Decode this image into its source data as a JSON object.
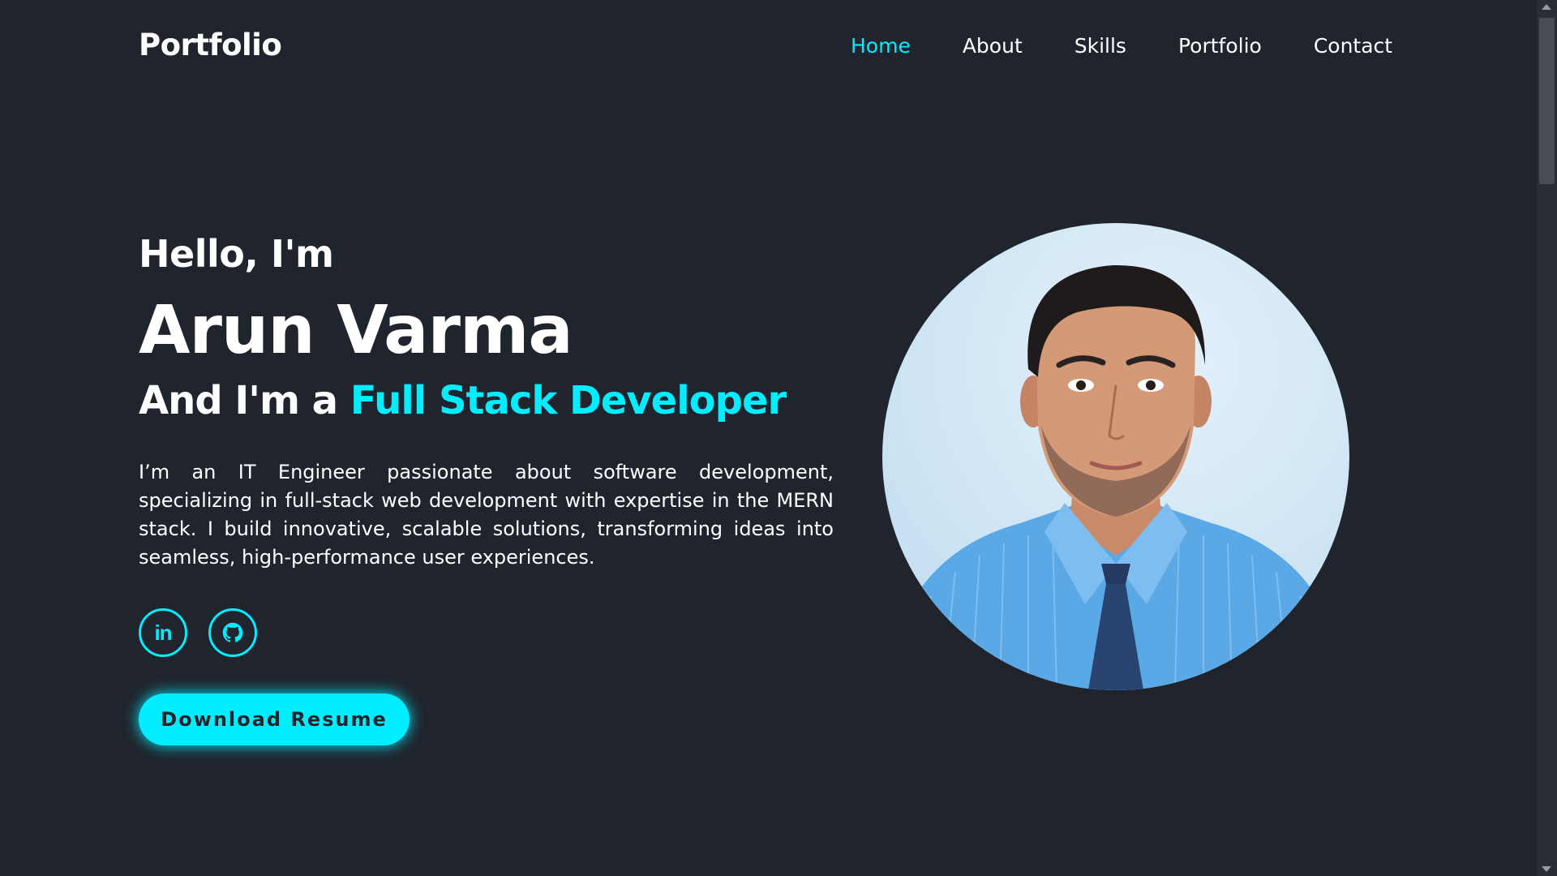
{
  "header": {
    "logo": "Portfolio",
    "nav": [
      {
        "label": "Home",
        "active": true
      },
      {
        "label": "About",
        "active": false
      },
      {
        "label": "Skills",
        "active": false
      },
      {
        "label": "Portfolio",
        "active": false
      },
      {
        "label": "Contact",
        "active": false
      }
    ]
  },
  "hero": {
    "greeting": "Hello, I'm",
    "name": "Arun Varma",
    "role_prefix": "And I'm a ",
    "role_highlight": "Full Stack Developer",
    "bio": "I’m an IT Engineer passionate about software development, specializing in full-stack web development with expertise in the MERN stack. I build innovative, scalable solutions, transforming ideas into seamless, high-performance user experiences.",
    "social": [
      {
        "name": "linkedin-icon",
        "glyph": "in"
      },
      {
        "name": "github-icon"
      }
    ],
    "cta_label": "Download Resume"
  },
  "colors": {
    "background": "#1f242d",
    "accent": "#00eeff",
    "text": "#ffffff"
  }
}
